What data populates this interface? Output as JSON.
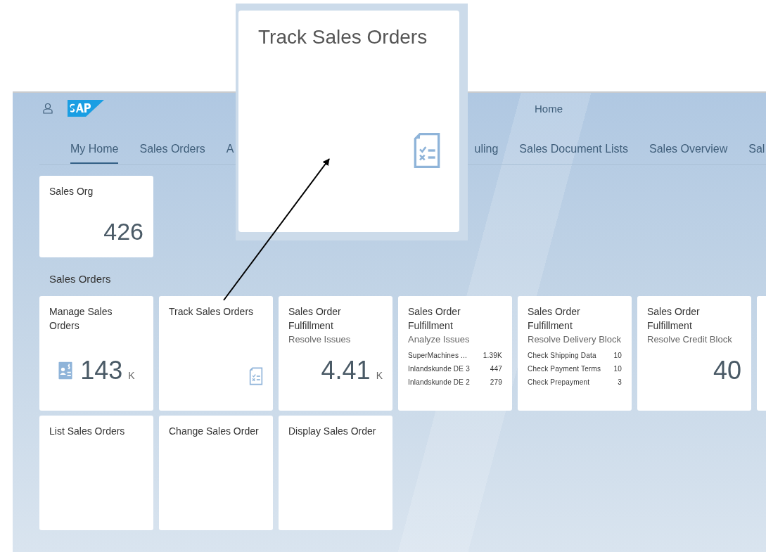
{
  "header": {
    "title": "Home",
    "nav": [
      {
        "label": "My Home",
        "selected": true
      },
      {
        "label": "Sales Orders",
        "selected": false
      },
      {
        "label": "A",
        "selected": false
      },
      {
        "label": "uling",
        "selected": false
      },
      {
        "label": "Sales Document Lists",
        "selected": false
      },
      {
        "label": "Sales Overview",
        "selected": false
      },
      {
        "label": "Sal",
        "selected": false
      }
    ]
  },
  "top_tiles": [
    {
      "kind": "number",
      "title": "Sales Org",
      "value": "426"
    }
  ],
  "group": {
    "title": "Sales Orders",
    "rows": [
      [
        {
          "kind": "kpi_icon",
          "title": "Manage Sales Orders",
          "value": "143",
          "unit": "K"
        },
        {
          "kind": "icon",
          "title": "Track Sales Orders"
        },
        {
          "kind": "kpi",
          "title": "Sales Order Fulfillment",
          "subtitle": "Resolve Issues",
          "value": "4.41",
          "unit": "K"
        },
        {
          "kind": "list",
          "title": "Sales Order Fulfillment",
          "subtitle": "Analyze Issues",
          "items": [
            {
              "name": "SuperMachines ...",
              "value": "1.39K"
            },
            {
              "name": "Inlandskunde DE 3",
              "value": "447"
            },
            {
              "name": "Inlandskunde DE 2",
              "value": "279"
            }
          ]
        },
        {
          "kind": "list",
          "title": "Sales Order Fulfillment",
          "subtitle": "Resolve Delivery Block",
          "items": [
            {
              "name": "Check Shipping Data",
              "value": "10"
            },
            {
              "name": "Check Payment Terms",
              "value": "10"
            },
            {
              "name": "Check Prepayment",
              "value": "3"
            }
          ]
        },
        {
          "kind": "kpi",
          "title": "Sales Order Fulfillment",
          "subtitle": "Resolve Credit Block",
          "value": "40"
        },
        {
          "kind": "blank"
        }
      ],
      [
        {
          "kind": "launch",
          "title": "List Sales Orders"
        },
        {
          "kind": "launch",
          "title": "Change Sales Order"
        },
        {
          "kind": "launch",
          "title": "Display Sales Order"
        }
      ]
    ]
  },
  "callout": {
    "title": "Track Sales Orders"
  }
}
